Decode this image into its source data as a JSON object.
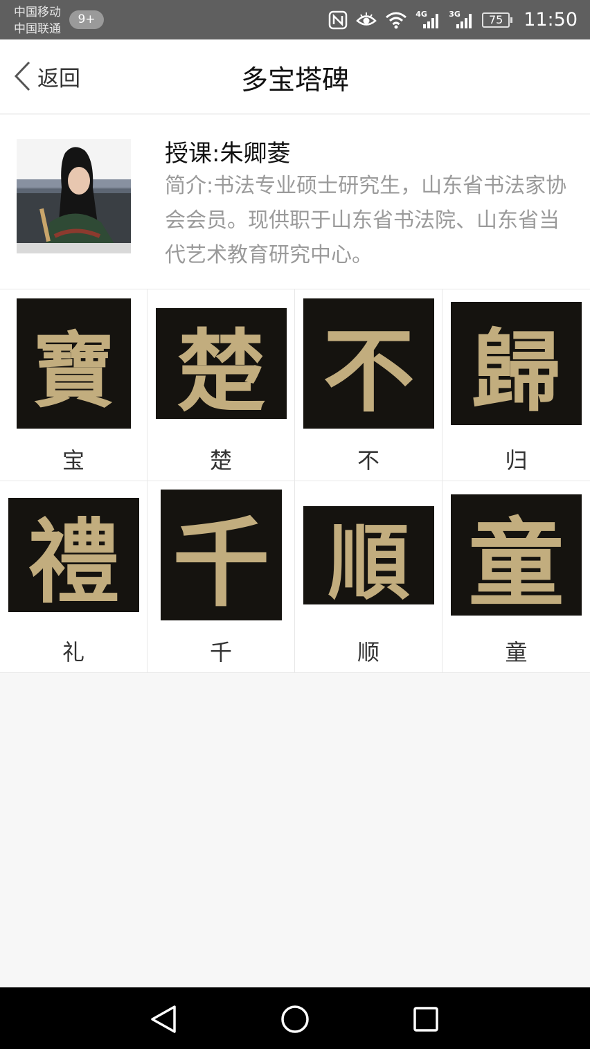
{
  "status_bar": {
    "carrier_1": "中国移动",
    "carrier_2": "中国联通",
    "notification_badge": "9+",
    "net_1": "4G",
    "net_2": "3G",
    "battery": "75",
    "time": "11:50"
  },
  "nav": {
    "back_label": "返回",
    "title": "多宝塔碑"
  },
  "teacher": {
    "name": "授课:朱卿菱",
    "intro": "简介:书法专业硕士研究生，山东省书法家协会会员。现供职于山东省书法院、山东省当代艺术教育研究中心。"
  },
  "characters": [
    {
      "label": "宝",
      "traditional": "寶"
    },
    {
      "label": "楚",
      "traditional": "楚"
    },
    {
      "label": "不",
      "traditional": "不"
    },
    {
      "label": "归",
      "traditional": "歸"
    },
    {
      "label": "礼",
      "traditional": "禮"
    },
    {
      "label": "千",
      "traditional": "千"
    },
    {
      "label": "顺",
      "traditional": "順"
    },
    {
      "label": "童",
      "traditional": "童"
    }
  ],
  "colors": {
    "status_bar_bg": "#5f5f5f",
    "ink_gold": "#c2ad7e",
    "rubbing_bg": "#15130f"
  }
}
